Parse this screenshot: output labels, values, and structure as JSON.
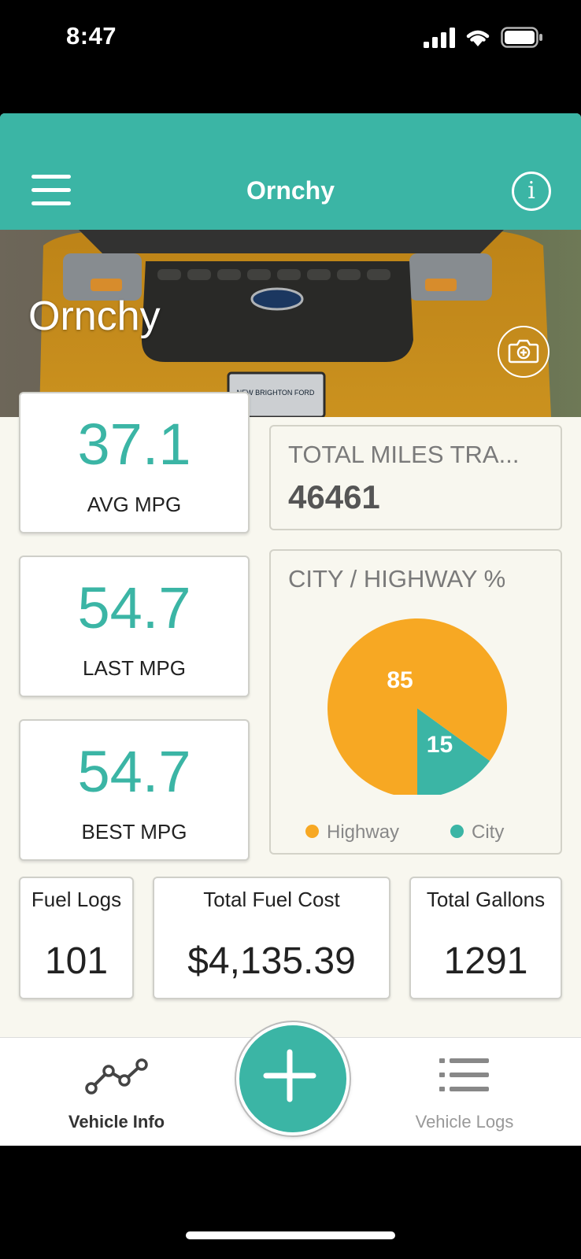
{
  "status_bar": {
    "time": "8:47"
  },
  "header": {
    "title": "Ornchy"
  },
  "hero": {
    "vehicle_name": "Ornchy",
    "plate_text": "NEW BRIGHTON FORD"
  },
  "mpg_cards": [
    {
      "value": "37.1",
      "label": "AVG MPG"
    },
    {
      "value": "54.7",
      "label": "LAST MPG"
    },
    {
      "value": "54.7",
      "label": "BEST MPG"
    }
  ],
  "total_miles": {
    "label": "TOTAL MILES TRA...",
    "value": "46461"
  },
  "chart_data": {
    "type": "pie",
    "title": "CITY / HIGHWAY %",
    "series": [
      {
        "name": "Highway",
        "value": 85,
        "color": "#f7a823"
      },
      {
        "name": "City",
        "value": 15,
        "color": "#3bb5a5"
      }
    ],
    "legend_position": "bottom"
  },
  "stats": [
    {
      "label": "Fuel Logs",
      "value": "101"
    },
    {
      "label": "Total Fuel Cost",
      "value": "$4,135.39"
    },
    {
      "label": "Total Gallons",
      "value": "1291"
    }
  ],
  "bottom_nav": {
    "vehicle_info": "Vehicle Info",
    "vehicle_logs": "Vehicle Logs",
    "active": "Vehicle Info"
  },
  "icons": [
    "menu-icon",
    "info-icon",
    "camera-add-icon",
    "line-chart-icon",
    "plus-icon",
    "list-icon"
  ],
  "colors": {
    "accent": "#3bb5a5",
    "highway": "#f7a823",
    "background": "#f8f7ef"
  }
}
